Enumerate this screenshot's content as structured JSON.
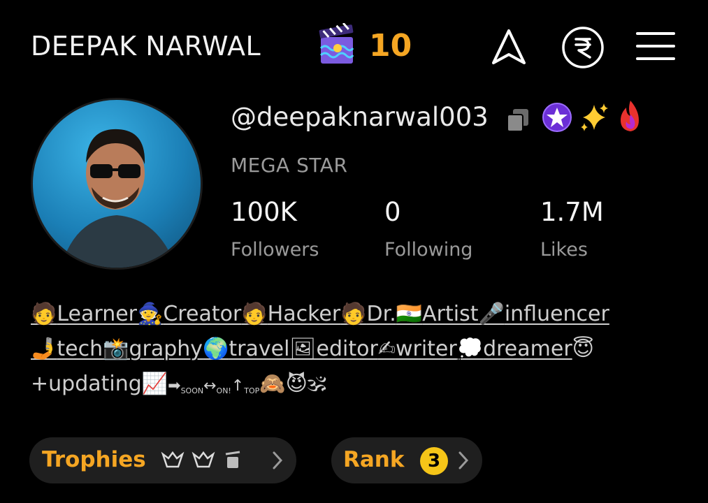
{
  "header": {
    "name": "DEEPAK NARWAL",
    "count": "10",
    "icons": [
      "clapperboard-icon",
      "navigation-icon",
      "rupee-icon",
      "menu-icon"
    ]
  },
  "profile": {
    "username": "@deepaknarwal003",
    "tier": "MEGA STAR",
    "stats": [
      {
        "value": "100K",
        "label": "Followers"
      },
      {
        "value": "0",
        "label": "Following"
      },
      {
        "value": "1.7M",
        "label": "Likes"
      }
    ]
  },
  "bio": {
    "line1": [
      "Learner",
      "Creator",
      "Hacker",
      "Dr.",
      "Artist",
      "influencer"
    ],
    "line2": [
      "tech",
      "graphy",
      "travel",
      "editor",
      "writer",
      "dreamer"
    ],
    "line3_text": "+updating",
    "arrow_labels": [
      "SOON",
      "ON!",
      "TOP"
    ]
  },
  "buttons": {
    "trophies": "Trophies",
    "rank": "Rank",
    "rank_value": "3"
  },
  "colors": {
    "accent": "#f5a623",
    "rank_badge": "#f5c518",
    "pill_bg": "#1f1f1f",
    "muted": "#9a9a9a"
  }
}
